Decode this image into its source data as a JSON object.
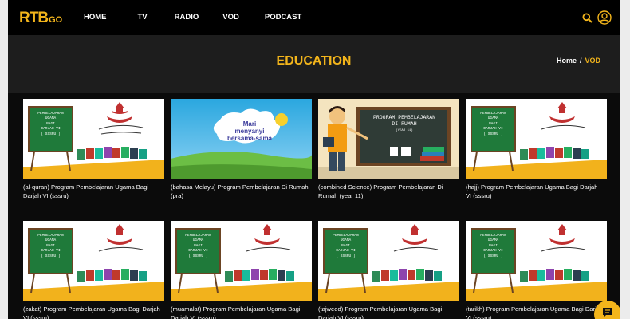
{
  "app": {
    "logo_main": "RTB",
    "logo_go": "GO"
  },
  "nav": {
    "items": [
      "HOME",
      "TV",
      "RADIO",
      "VOD",
      "PODCAST"
    ]
  },
  "header": {
    "search_icon": "search-icon",
    "user_icon": "user-icon"
  },
  "page": {
    "title": "EDUCATION",
    "breadcrumb": {
      "home": "Home",
      "sep": "/",
      "current": "VOD"
    }
  },
  "thumb_text": {
    "board": [
      "PEMBELAJARAN",
      "UGAMA",
      "BAGI",
      "DARJAH VI",
      "( SSSRU )"
    ],
    "sing_line1": "Mari",
    "sing_line2": "menyanyi",
    "sing_line3": "bersama-sama",
    "rumah_line1": "PROGRAM PEMBELAJARAN",
    "rumah_line2": "DI RUMAH",
    "rumah_line3": "(YEAR 11)"
  },
  "cards": [
    {
      "caption": "(al-quran) Program Pembelajaran Ugama Bagi Darjah VI (sssru)",
      "kind": "ugama"
    },
    {
      "caption": "(bahasa Melayu) Program Pembelajaran Di Rumah (pra)",
      "kind": "sing"
    },
    {
      "caption": "(combined Science) Program Pembelajaran Di Rumah (year 11)",
      "kind": "rumah"
    },
    {
      "caption": "(hajj) Program Pembelajaran Ugama Bagi Darjah VI (sssru)",
      "kind": "ugama"
    },
    {
      "caption": "(zakat) Program Pembelajaran Ugama Bagi Darjah VI (sssru)",
      "kind": "ugama"
    },
    {
      "caption": "(muamalat) Program Pembelajaran Ugama Bagi Darjah VI (sssru)",
      "kind": "ugama"
    },
    {
      "caption": "(tajweed) Program Pembelajaran Ugama Bagi Darjah VI (sssru)",
      "kind": "ugama"
    },
    {
      "caption": "(tarikh) Program Pembelajaran Ugama Bagi Darjah VI (sssru)",
      "kind": "ugama"
    }
  ],
  "colors": {
    "accent": "#f3b51b",
    "board_green": "#1f7a3a",
    "background": "#0b0b0b"
  },
  "chat": {
    "icon": "chat-icon"
  }
}
